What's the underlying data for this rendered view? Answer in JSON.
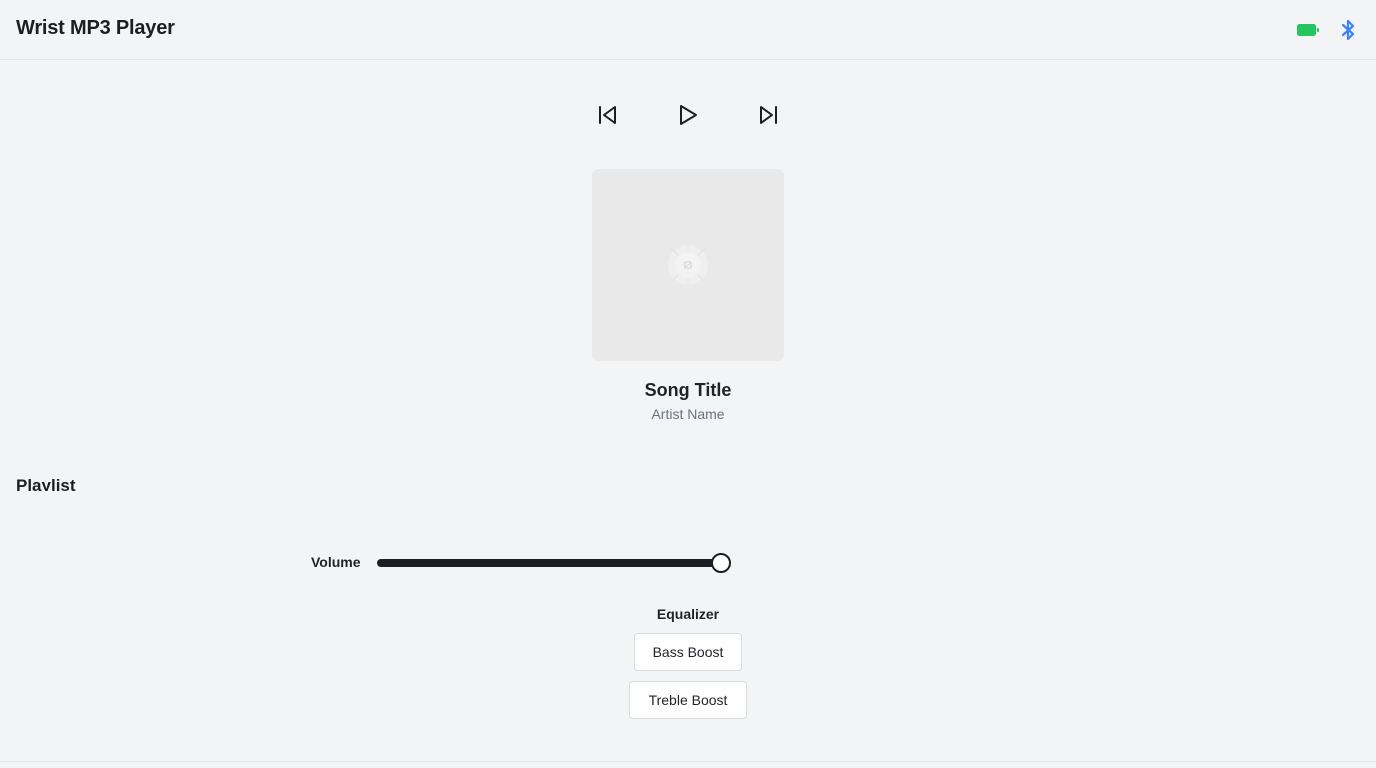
{
  "header": {
    "title": "Wrist MP3 Player",
    "battery_icon": "battery-icon",
    "bluetooth_icon": "bluetooth-icon"
  },
  "colors": {
    "battery": "#22c55e",
    "bluetooth": "#3b82f6",
    "background": "#f2f4f6",
    "text": "#1f2328",
    "muted": "#6b7280"
  },
  "controls": {
    "previous_icon": "skip-previous-icon",
    "play_icon": "play-icon",
    "next_icon": "skip-next-icon"
  },
  "now_playing": {
    "song_title": "Song Title",
    "artist_name": "Artist Name"
  },
  "playlist": {
    "heading": "Playlist"
  },
  "volume": {
    "label": "Volume",
    "level": 1.0
  },
  "equalizer": {
    "label": "Equalizer",
    "presets": [
      "Bass Boost",
      "Treble Boost"
    ]
  }
}
